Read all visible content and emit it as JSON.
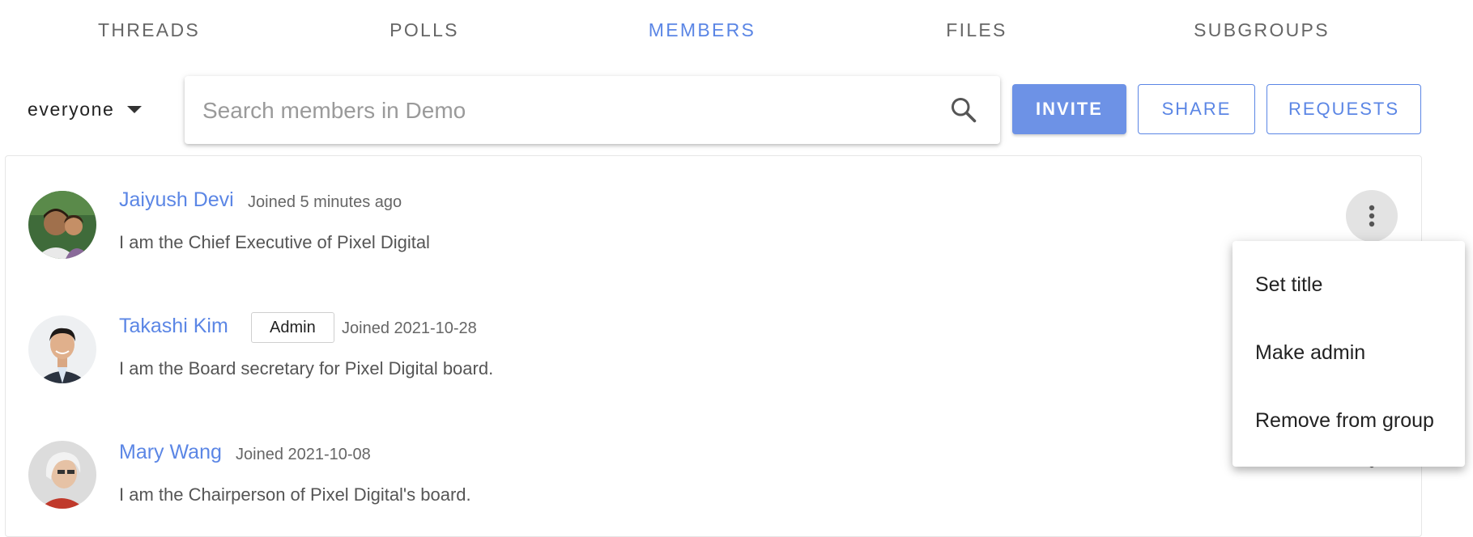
{
  "tabs": [
    {
      "label": "THREADS",
      "active": false
    },
    {
      "label": "POLLS",
      "active": false
    },
    {
      "label": "MEMBERS",
      "active": true
    },
    {
      "label": "FILES",
      "active": false
    },
    {
      "label": "SUBGROUPS",
      "active": false
    }
  ],
  "toolbar": {
    "filter_label": "everyone",
    "search_placeholder": "Search members in Demo",
    "search_value": "",
    "invite_label": "INVITE",
    "share_label": "SHARE",
    "requests_label": "REQUESTS"
  },
  "members": [
    {
      "name": "Jaiyush Devi",
      "badge": "",
      "joined": "Joined 5 minutes ago",
      "bio": "I am the Chief Executive of Pixel Digital"
    },
    {
      "name": "Takashi Kim",
      "badge": "Admin",
      "joined": "Joined 2021-10-28",
      "bio": "I am the Board secretary for Pixel Digital board."
    },
    {
      "name": "Mary Wang",
      "badge": "",
      "joined": "Joined 2021-10-08",
      "bio": "I am the Chairperson of Pixel Digital's board."
    }
  ],
  "menu": {
    "items": [
      "Set title",
      "Make admin",
      "Remove from group"
    ]
  },
  "colors": {
    "accent": "#5b86e5",
    "invite_bg": "#6d92e6",
    "tab_inactive": "#666666"
  },
  "icons": {
    "search": "search-icon",
    "caret": "caret-down-icon",
    "more": "more-vert-icon"
  }
}
